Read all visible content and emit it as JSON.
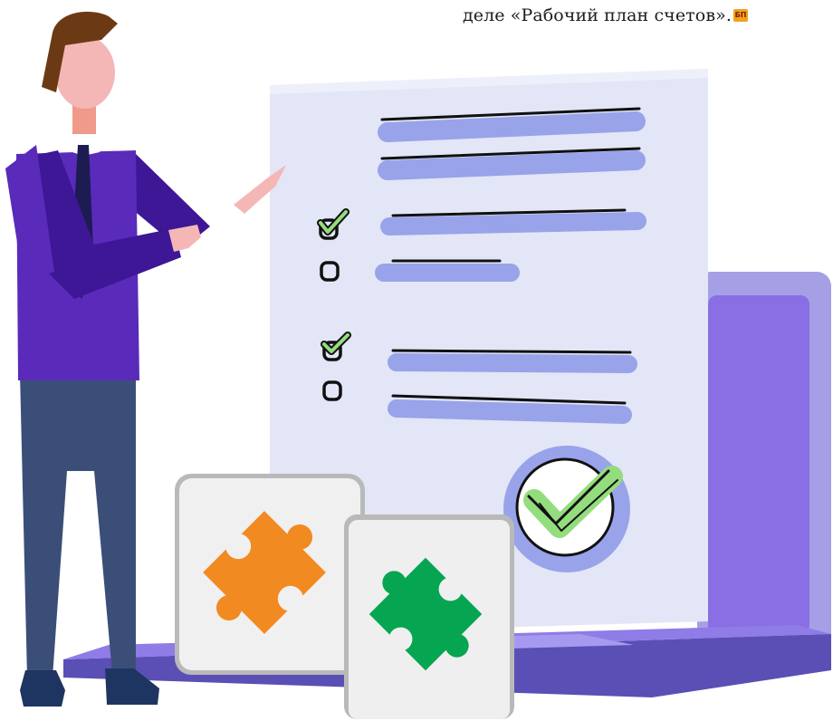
{
  "caption": {
    "text": "деле «Рабочий план счетов».",
    "badge": "БП"
  },
  "illustration": {
    "checklist_items": [
      {
        "state": "checked"
      },
      {
        "state": "unchecked"
      },
      {
        "state": "checked"
      },
      {
        "state": "unchecked"
      }
    ],
    "puzzle_pieces": [
      {
        "color": "#f28a22"
      },
      {
        "color": "#05a552"
      }
    ],
    "colors": {
      "document": "#e2e6f6",
      "lines": "#98a3ea",
      "laptop": "#8f6fe6",
      "shirt": "#5a2aba",
      "pants": "#3b4e78",
      "check_green": "#94dd7e"
    }
  }
}
